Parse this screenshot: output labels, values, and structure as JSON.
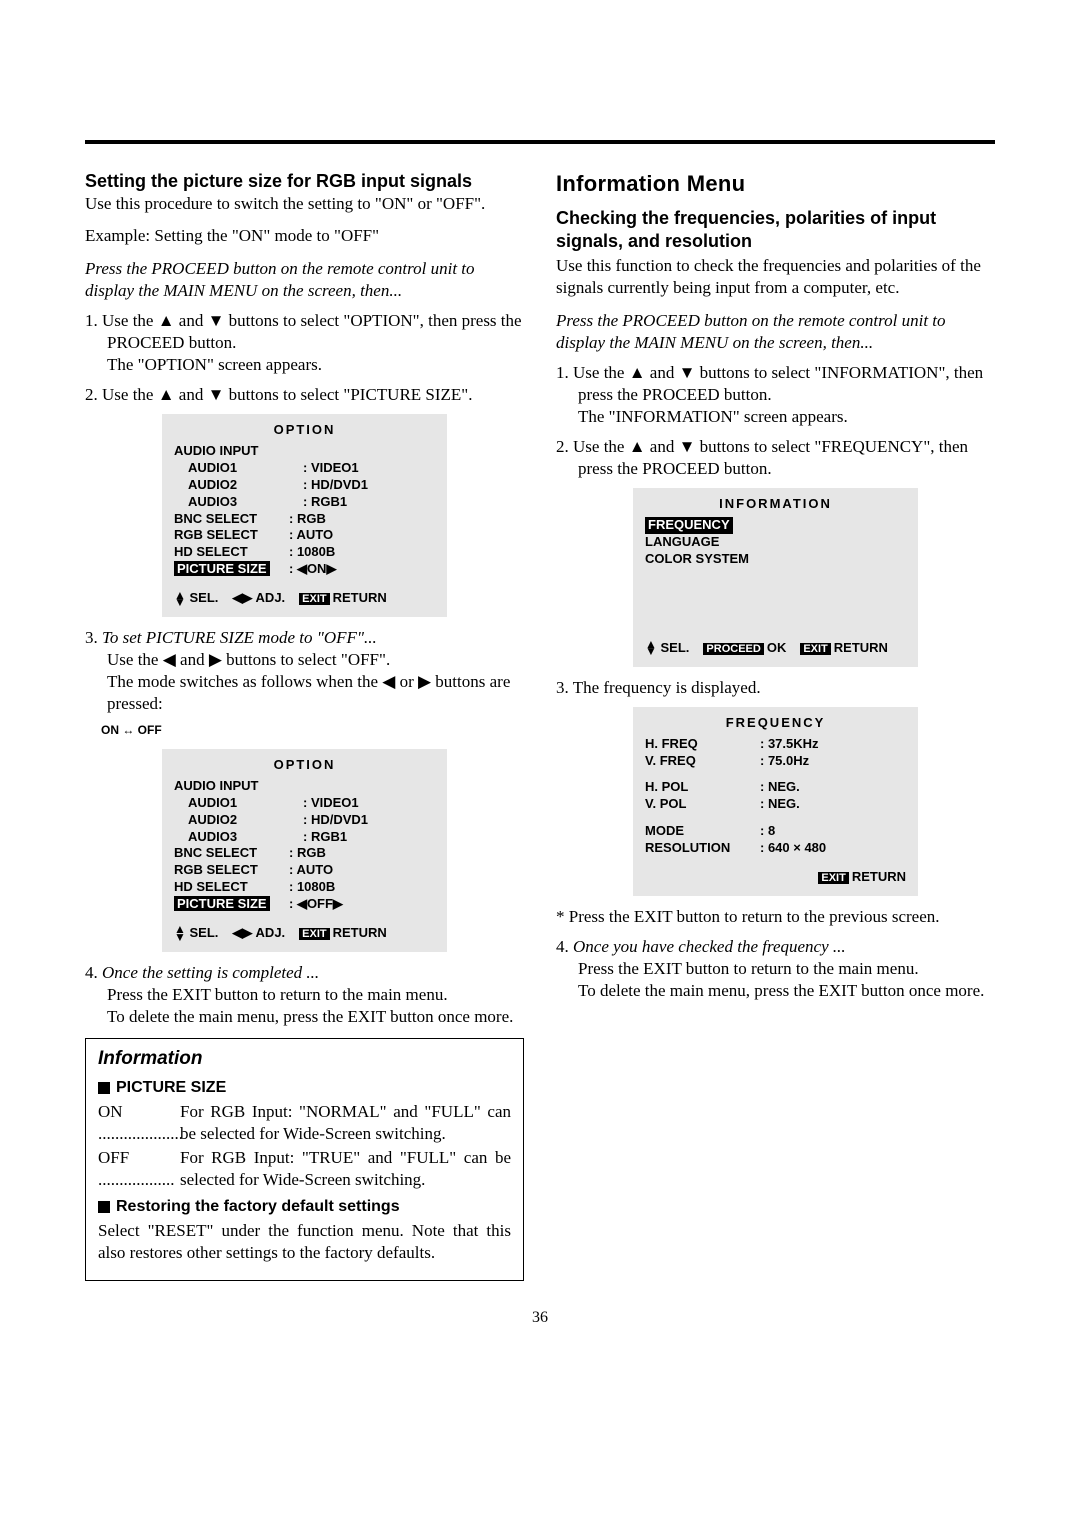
{
  "left": {
    "heading": "Setting the picture size for RGB input signals",
    "intro": "Use this procedure to switch the setting to \"ON\" or \"OFF\".",
    "example": "Example: Setting the \"ON\" mode to \"OFF\"",
    "press": "Press the PROCEED button on the remote control unit to display the MAIN MENU on the screen, then...",
    "step1_no": "1.",
    "step1a": "Use the ▲ and ▼ buttons to select \"OPTION\", then press the PROCEED button.",
    "step1b": "The \"OPTION\" screen appears.",
    "step2_no": "2.",
    "step2": "Use the ▲ and ▼ buttons to select \"PICTURE SIZE\".",
    "step3_no": "3.",
    "step3_lead": "To set PICTURE SIZE mode to \"OFF\"...",
    "step3a": "Use the ◀ and ▶ buttons to select \"OFF\".",
    "step3b": "The mode switches as follows when the ◀ or ▶ buttons are pressed:",
    "toggle": "ON ↔ OFF",
    "step4_no": "4.",
    "step4_lead": "Once the setting is completed ...",
    "step4a": "Press the EXIT button to return to the main menu.",
    "step4b": "To delete the main menu, press the EXIT button once more.",
    "osd": {
      "title": "OPTION",
      "audio_input": "AUDIO INPUT",
      "rows": [
        {
          "l": "AUDIO1",
          "v": ":   VIDEO1",
          "indent": true
        },
        {
          "l": "AUDIO2",
          "v": ":   HD/DVD1",
          "indent": true
        },
        {
          "l": "AUDIO3",
          "v": ":   RGB1",
          "indent": true
        },
        {
          "l": "BNC SELECT",
          "v": ":   RGB"
        },
        {
          "l": "RGB SELECT",
          "v": ":   AUTO"
        },
        {
          "l": "HD SELECT",
          "v": ":   1080B"
        }
      ],
      "ps_label": "PICTURE SIZE",
      "ps_on": ": ◀ON▶",
      "ps_off": ": ◀OFF▶",
      "sel": "SEL.",
      "adj": "◀▶ ADJ.",
      "exit": "EXIT",
      "return": "RETURN"
    },
    "infobox": {
      "title": "Information",
      "sec1": "PICTURE SIZE",
      "on_l": "ON ....................",
      "on_r": "For RGB Input: \"NORMAL\" and \"FULL\" can be selected for Wide-Screen switching.",
      "off_l": "OFF ..................",
      "off_r": "For RGB Input: \"TRUE\" and \"FULL\" can be selected for Wide-Screen switching.",
      "sec2": "Restoring the factory default settings",
      "restore": "Select \"RESET\" under the function menu. Note that this also restores other settings to the factory defaults."
    }
  },
  "right": {
    "title": "Information Menu",
    "heading": "Checking the frequencies, polarities of input signals, and resolution",
    "intro": "Use this function to check the frequencies and polarities of the signals currently being input from a computer, etc.",
    "press": "Press the PROCEED button on the remote control unit to display the MAIN MENU on the screen, then...",
    "step1_no": "1.",
    "step1a": "Use the ▲ and ▼ buttons to select \"INFORMATION\", then press the PROCEED button.",
    "step1b": "The \"INFORMATION\" screen appears.",
    "step2_no": "2.",
    "step2": "Use the ▲ and ▼ buttons to select \"FREQUENCY\", then press the PROCEED button.",
    "step3_no": "3.",
    "step3": "The frequency is displayed.",
    "note": "* Press the EXIT button to return to the previous screen.",
    "step4_no": "4.",
    "step4_lead": "Once you have checked the frequency ...",
    "step4a": "Press the EXIT button to return to the main menu.",
    "step4b": "To delete the main menu, press the EXIT button once more.",
    "osd_info": {
      "title": "INFORMATION",
      "freq": "FREQUENCY",
      "lang": "LANGUAGE",
      "cs": "COLOR SYSTEM",
      "sel": "SEL.",
      "proceed": "PROCEED",
      "ok": "OK",
      "exit": "EXIT",
      "return": "RETURN"
    },
    "osd_freq": {
      "title": "FREQUENCY",
      "rows": [
        {
          "l": "H. FREQ",
          "v": ": 37.5KHz"
        },
        {
          "l": "V. FREQ",
          "v": ": 75.0Hz"
        },
        {
          "l": "",
          "v": ""
        },
        {
          "l": "H. POL",
          "v": ": NEG."
        },
        {
          "l": "V. POL",
          "v": ": NEG."
        },
        {
          "l": "",
          "v": ""
        },
        {
          "l": "MODE",
          "v": ": 8"
        },
        {
          "l": "RESOLUTION",
          "v": ": 640 × 480"
        }
      ],
      "exit": "EXIT",
      "return": "RETURN"
    }
  },
  "page_number": "36"
}
